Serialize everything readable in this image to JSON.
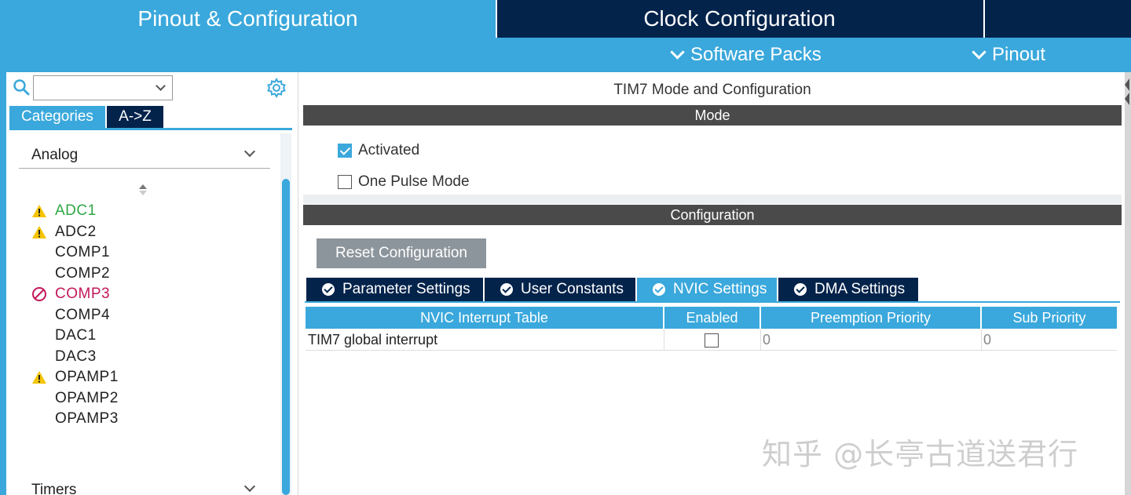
{
  "header": {
    "tabs": [
      {
        "label": "Pinout & Configuration",
        "active": true
      },
      {
        "label": "Clock Configuration",
        "active": false
      }
    ],
    "subnav": [
      {
        "label": "Software Packs"
      },
      {
        "label": "Pinout"
      }
    ]
  },
  "sidebar": {
    "search": {
      "value": "",
      "placeholder": ""
    },
    "view_tabs": [
      {
        "label": "Categories",
        "active": true
      },
      {
        "label": "A->Z",
        "active": false
      }
    ],
    "groups": [
      {
        "label": "Analog"
      },
      {
        "label": "Timers"
      }
    ],
    "analog_items": [
      {
        "label": "ADC1",
        "status": "warning-active"
      },
      {
        "label": "ADC2",
        "status": "warning"
      },
      {
        "label": "COMP1",
        "status": "none"
      },
      {
        "label": "COMP2",
        "status": "none"
      },
      {
        "label": "COMP3",
        "status": "disabled"
      },
      {
        "label": "COMP4",
        "status": "none"
      },
      {
        "label": "DAC1",
        "status": "none"
      },
      {
        "label": "DAC3",
        "status": "none"
      },
      {
        "label": "OPAMP1",
        "status": "warning"
      },
      {
        "label": "OPAMP2",
        "status": "none"
      },
      {
        "label": "OPAMP3",
        "status": "none"
      }
    ]
  },
  "main": {
    "title": "TIM7 Mode and Configuration",
    "mode_section": "Mode",
    "mode_options": [
      {
        "label": "Activated",
        "checked": true
      },
      {
        "label": "One Pulse Mode",
        "checked": false
      }
    ],
    "config_section": "Configuration",
    "reset_label": "Reset Configuration",
    "config_tabs": [
      {
        "label": "Parameter Settings",
        "active": false
      },
      {
        "label": "User Constants",
        "active": false
      },
      {
        "label": "NVIC Settings",
        "active": true
      },
      {
        "label": "DMA Settings",
        "active": false
      }
    ],
    "nvic_table": {
      "columns": [
        "NVIC Interrupt Table",
        "Enabled",
        "Preemption Priority",
        "Sub Priority"
      ],
      "rows": [
        {
          "name": "TIM7 global interrupt",
          "enabled": false,
          "preemption": "0",
          "sub": "0"
        }
      ]
    }
  },
  "watermark": "知乎 @长亭古道送君行",
  "colors": {
    "accent": "#3aa8dc",
    "navy": "#03234b",
    "section_bar": "#4a4a4a",
    "warning": "#f5c400",
    "disabled": "#c2185b",
    "active_item": "#2fa745"
  }
}
